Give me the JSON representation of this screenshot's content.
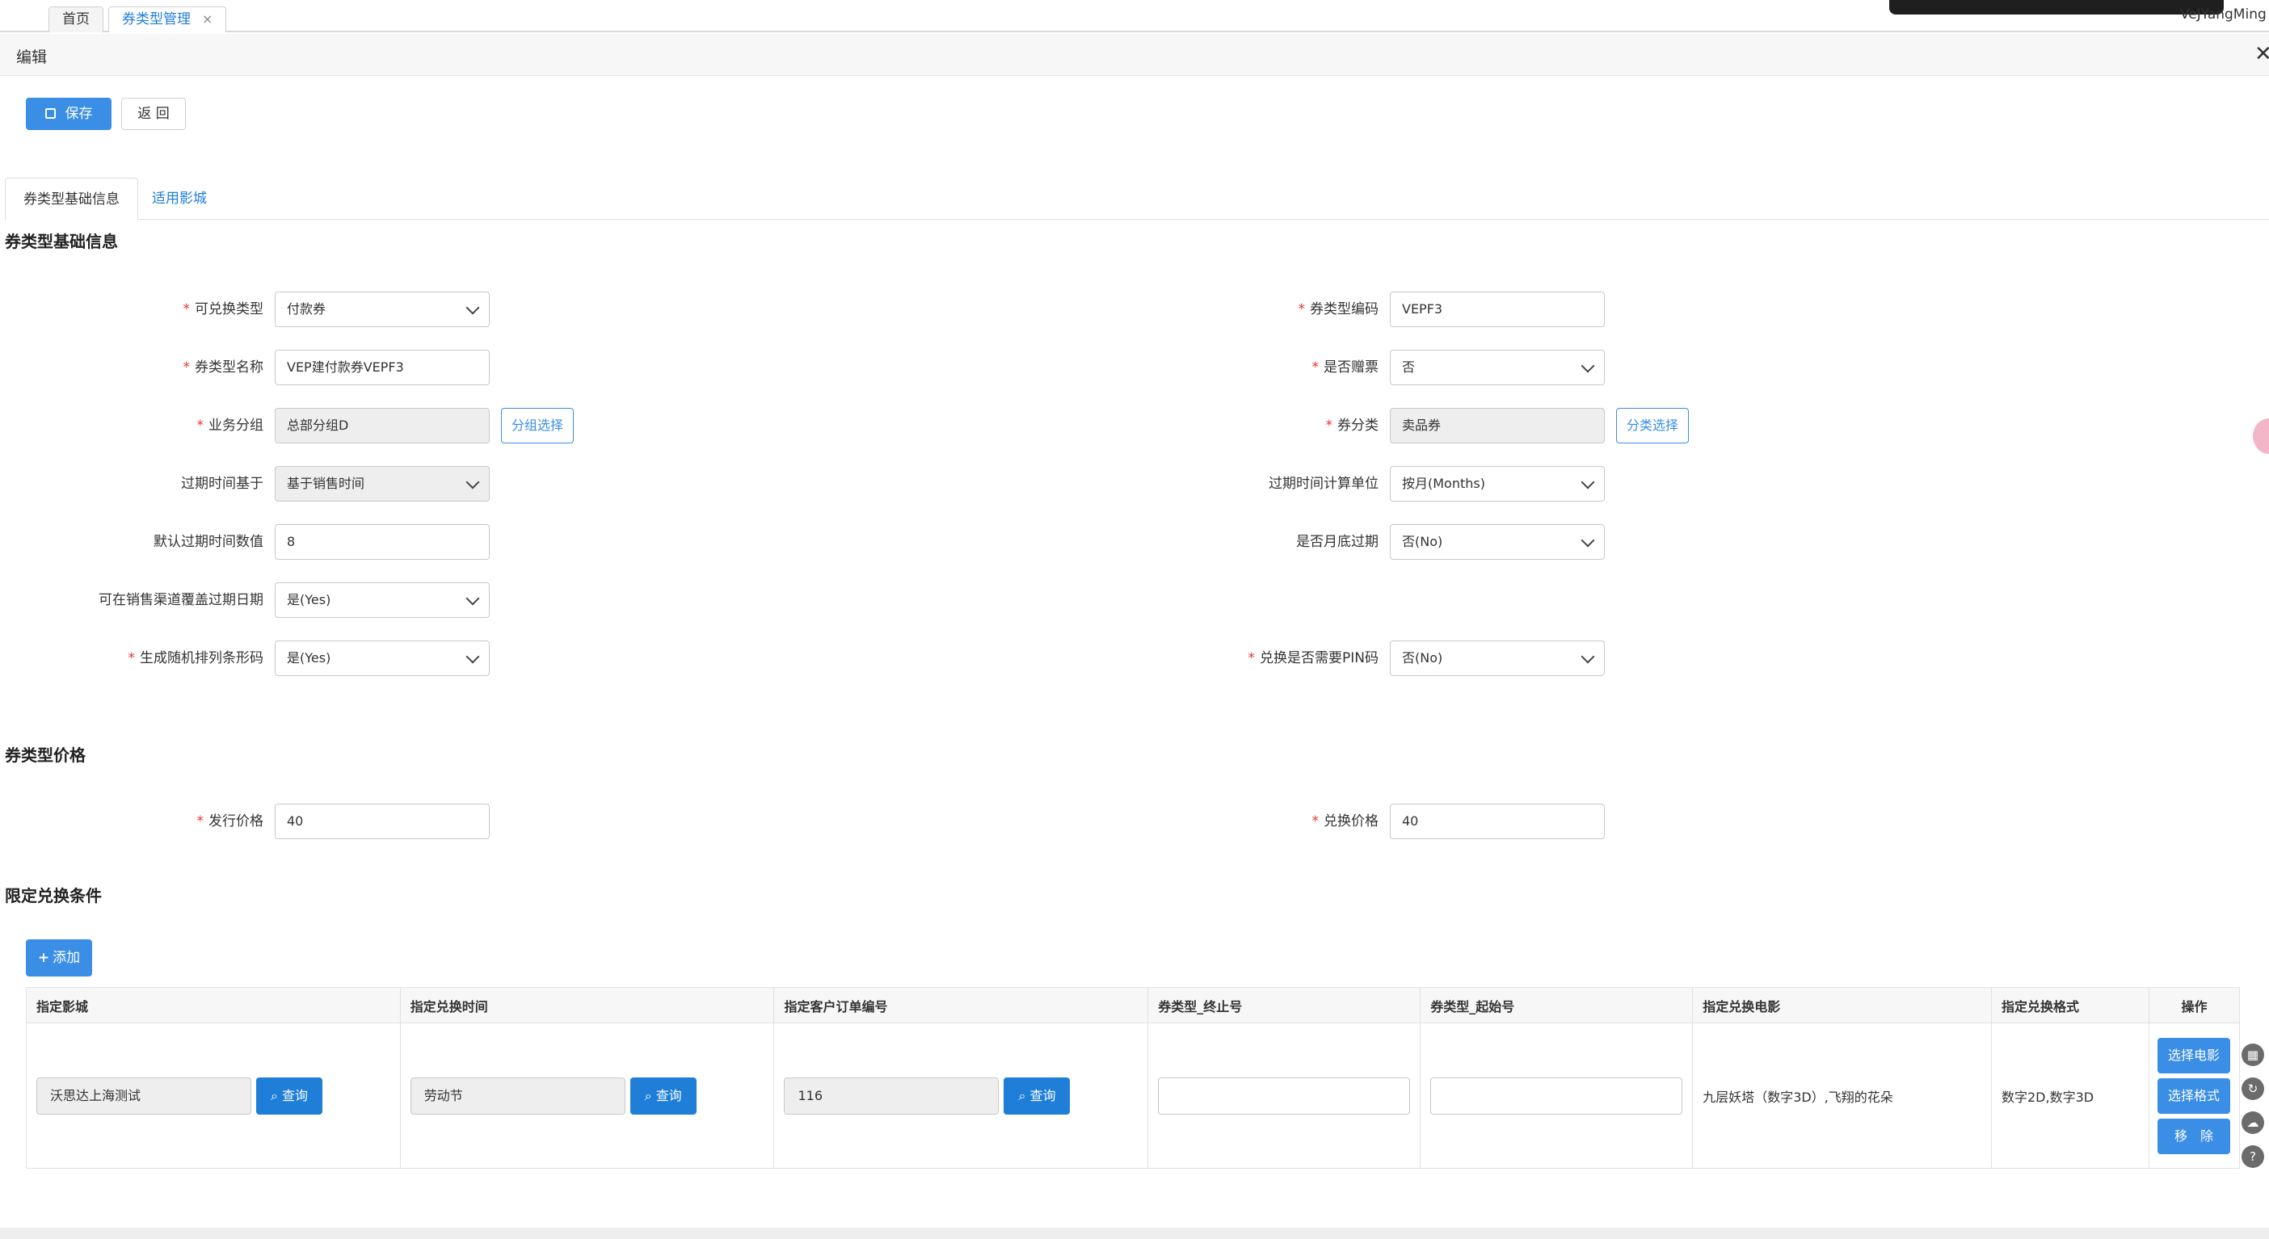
{
  "tabs": [
    {
      "label": "首页"
    },
    {
      "label": "券类型管理",
      "close": "×"
    }
  ],
  "user": {
    "name": "VeJYangMing"
  },
  "edit": {
    "title": "编辑",
    "close": "✕"
  },
  "toolbar": {
    "save_label": "保存",
    "back_label": "返 回"
  },
  "form_tabs": [
    {
      "label": "券类型基础信息"
    },
    {
      "label": "适用影城"
    }
  ],
  "sections": {
    "basic": "券类型基础信息",
    "price": "券类型价格",
    "conditions": "限定兑换条件"
  },
  "basic": {
    "exchange_type": {
      "label": "可兑换类型",
      "required": "*",
      "value": "付款券"
    },
    "type_code": {
      "label": "券类型编码",
      "required": "*",
      "value": "VEPF3"
    },
    "type_name": {
      "label": "券类型名称",
      "required": "*",
      "value": "VEP建付款券VEPF3"
    },
    "is_gift": {
      "label": "是否赠票",
      "required": "*",
      "value": "否"
    },
    "business_group": {
      "label": "业务分组",
      "required": "*",
      "value": "总部分组D",
      "button": "分组选择"
    },
    "category": {
      "label": "券分类",
      "required": "*",
      "value": "卖品券",
      "button": "分类选择"
    },
    "expire_base": {
      "label": "过期时间基于",
      "value": "基于销售时间"
    },
    "expire_unit": {
      "label": "过期时间计算单位",
      "value": "按月(Months)"
    },
    "default_expire": {
      "label": "默认过期时间数值",
      "value": "8"
    },
    "month_end": {
      "label": "是否月底过期",
      "value": "否(No)"
    },
    "override_expire": {
      "label": "可在销售渠道覆盖过期日期",
      "value": "是(Yes)"
    },
    "random_barcode": {
      "label": "生成随机排列条形码",
      "required": "*",
      "value": "是(Yes)"
    },
    "need_pin": {
      "label": "兑换是否需要PIN码",
      "required": "*",
      "value": "否(No)"
    }
  },
  "price": {
    "issue_price": {
      "label": "发行价格",
      "required": "*",
      "value": "40"
    },
    "exchange_price": {
      "label": "兑换价格",
      "required": "*",
      "value": "40"
    }
  },
  "conditions": {
    "add_label": "添加",
    "columns": [
      "指定影城",
      "指定兑换时间",
      "指定客户订单编号",
      "券类型_终止号",
      "券类型_起始号",
      "指定兑换电影",
      "指定兑换格式",
      "操作"
    ],
    "row": {
      "cinema": "沃思达上海测试",
      "time": "劳动节",
      "order_no": "116",
      "end_no": "",
      "start_no": "",
      "movies": "九层妖塔（数字3D）,飞翔的花朵",
      "formats": "数字2D,数字3D",
      "query_label": "查询",
      "ops": [
        "选择电影",
        "选择格式",
        "移　除"
      ]
    }
  }
}
